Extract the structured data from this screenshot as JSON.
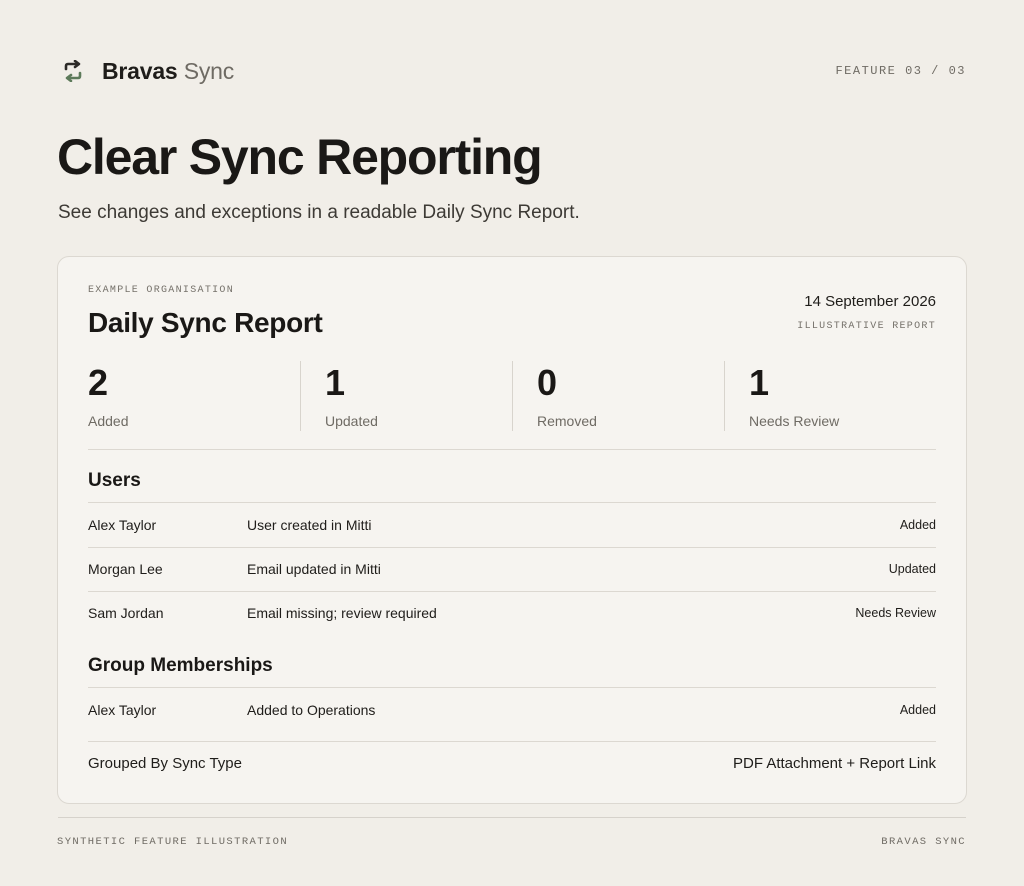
{
  "header": {
    "brand_strong": "Bravas",
    "brand_light": "Sync",
    "feature_counter": "FEATURE 03 / 03"
  },
  "hero": {
    "title": "Clear Sync Reporting",
    "subtitle": "See changes and exceptions in a readable Daily Sync Report."
  },
  "report": {
    "org_label": "EXAMPLE ORGANISATION",
    "title": "Daily Sync Report",
    "date": "14 September 2026",
    "kind": "ILLUSTRATIVE REPORT",
    "stats": [
      {
        "value": "2",
        "label": "Added"
      },
      {
        "value": "1",
        "label": "Updated"
      },
      {
        "value": "0",
        "label": "Removed"
      },
      {
        "value": "1",
        "label": "Needs Review"
      }
    ],
    "sections": [
      {
        "title": "Users",
        "rows": [
          {
            "name": "Alex Taylor",
            "desc": "User created in Mitti",
            "status": "Added"
          },
          {
            "name": "Morgan Lee",
            "desc": "Email updated in Mitti",
            "status": "Updated"
          },
          {
            "name": "Sam Jordan",
            "desc": "Email missing; review required",
            "status": "Needs Review"
          }
        ]
      },
      {
        "title": "Group Memberships",
        "rows": [
          {
            "name": "Alex Taylor",
            "desc": "Added to Operations",
            "status": "Added"
          }
        ]
      }
    ],
    "footer_left": "Grouped By Sync Type",
    "footer_right": "PDF Attachment + Report Link"
  },
  "page_footer": {
    "left": "SYNTHETIC FEATURE ILLUSTRATION",
    "right": "BRAVAS SYNC"
  },
  "colors": {
    "background": "#f1eee8",
    "card": "#f6f4f0",
    "icon_green": "#5d7a5a",
    "text_dark": "#1a1816"
  },
  "icons": {
    "brand": "sync-arrows-icon"
  }
}
